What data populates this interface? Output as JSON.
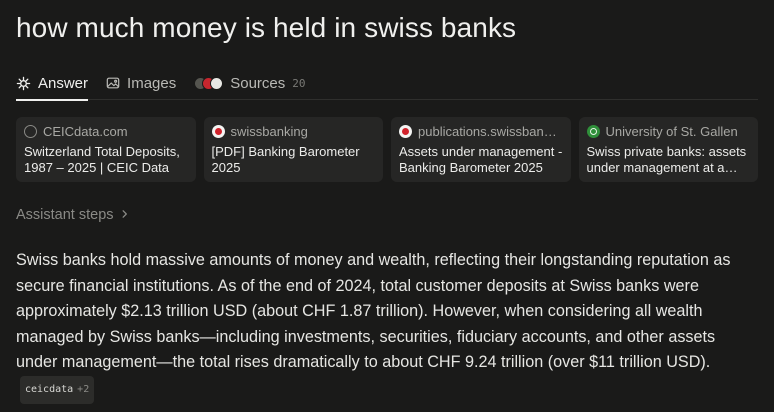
{
  "query": "how much money is held in swiss banks",
  "tabs": [
    {
      "label": "Answer",
      "icon": "sparkle-icon",
      "active": true
    },
    {
      "label": "Images",
      "icon": "image-icon",
      "active": false
    },
    {
      "label": "Sources",
      "icon": "source-stack-icon",
      "count": "20",
      "active": false
    }
  ],
  "sources": [
    {
      "domain": "CEICdata.com",
      "title": "Switzerland Total Deposits, 1987 – 2025 | CEIC Data",
      "icon": "globe-icon"
    },
    {
      "domain": "swissbanking",
      "title": "[PDF] Banking Barometer 2025",
      "icon": "swissbanking-favicon"
    },
    {
      "domain": "publications.swissbanking.ch",
      "title": "Assets under management - Banking Barometer 2025",
      "icon": "swissbanking-favicon"
    },
    {
      "domain": "University of St. Gallen",
      "title": "Swiss private banks: assets under management at a glance",
      "icon": "hsg-favicon"
    }
  ],
  "assistant_steps": "Assistant steps",
  "answer": {
    "text": "Swiss banks hold massive amounts of money and wealth, reflecting their longstanding reputation as secure financial institutions. As of the end of 2024, total customer deposits at Swiss banks were approximately $2.13 trillion USD (about CHF 1.87 trillion). However, when considering all wealth managed by Swiss banks—including investments, securities, fiduciary accounts, and other assets under management—the total rises dramatically to about CHF 9.24 trillion (over $11 trillion USD).",
    "citation": {
      "label": "ceicdata",
      "extra": "+2"
    }
  },
  "colors": {
    "background": "#1a1a19",
    "card": "#262625",
    "text": "#e6e6e3",
    "muted": "#8a8a86"
  }
}
